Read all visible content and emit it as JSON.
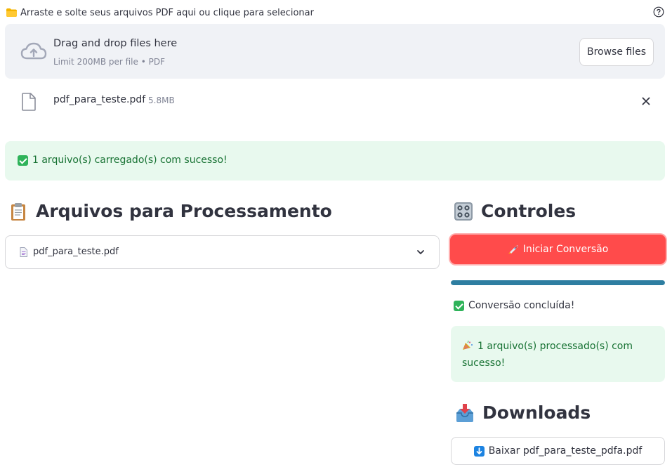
{
  "uploader": {
    "label": "Arraste e solte seus arquivos PDF aqui ou clique para selecionar",
    "drop_title": "Drag and drop files here",
    "drop_sub": "Limit 200MB per file • PDF",
    "browse_label": "Browse files"
  },
  "uploaded_file": {
    "name": "pdf_para_teste.pdf",
    "size": "5.8MB"
  },
  "upload_success": "1 arquivo(s) carregado(s) com sucesso!",
  "files_section": {
    "title": "Arquivos para Processamento",
    "items": [
      {
        "label": "pdf_para_teste.pdf"
      }
    ]
  },
  "controls": {
    "title": "Controles",
    "start_label": "Iniciar Conversão",
    "progress": 1.0,
    "done_text": "Conversão concluída!",
    "processed_text": "1 arquivo(s) processado(s) com sucesso!"
  },
  "downloads": {
    "title": "Downloads",
    "button_label": "Baixar pdf_para_teste_pdfa.pdf"
  },
  "colors": {
    "primary": "#ff4b4b",
    "success_bg": "#e8f9ee",
    "success_text": "#177233",
    "progress": "#2e7ea1",
    "info": "#1c83e1"
  },
  "icons": {
    "uploader": "folder-icon",
    "help": "help-icon",
    "upload": "cloud-upload-icon",
    "file": "file-icon",
    "remove": "close-icon",
    "check": "check-icon",
    "files_heading": "clipboard-icon",
    "controls_heading": "control-knobs-icon",
    "start": "rocket-icon",
    "processed": "party-popper-icon",
    "downloads_heading": "inbox-tray-icon",
    "download": "down-arrow-icon"
  }
}
